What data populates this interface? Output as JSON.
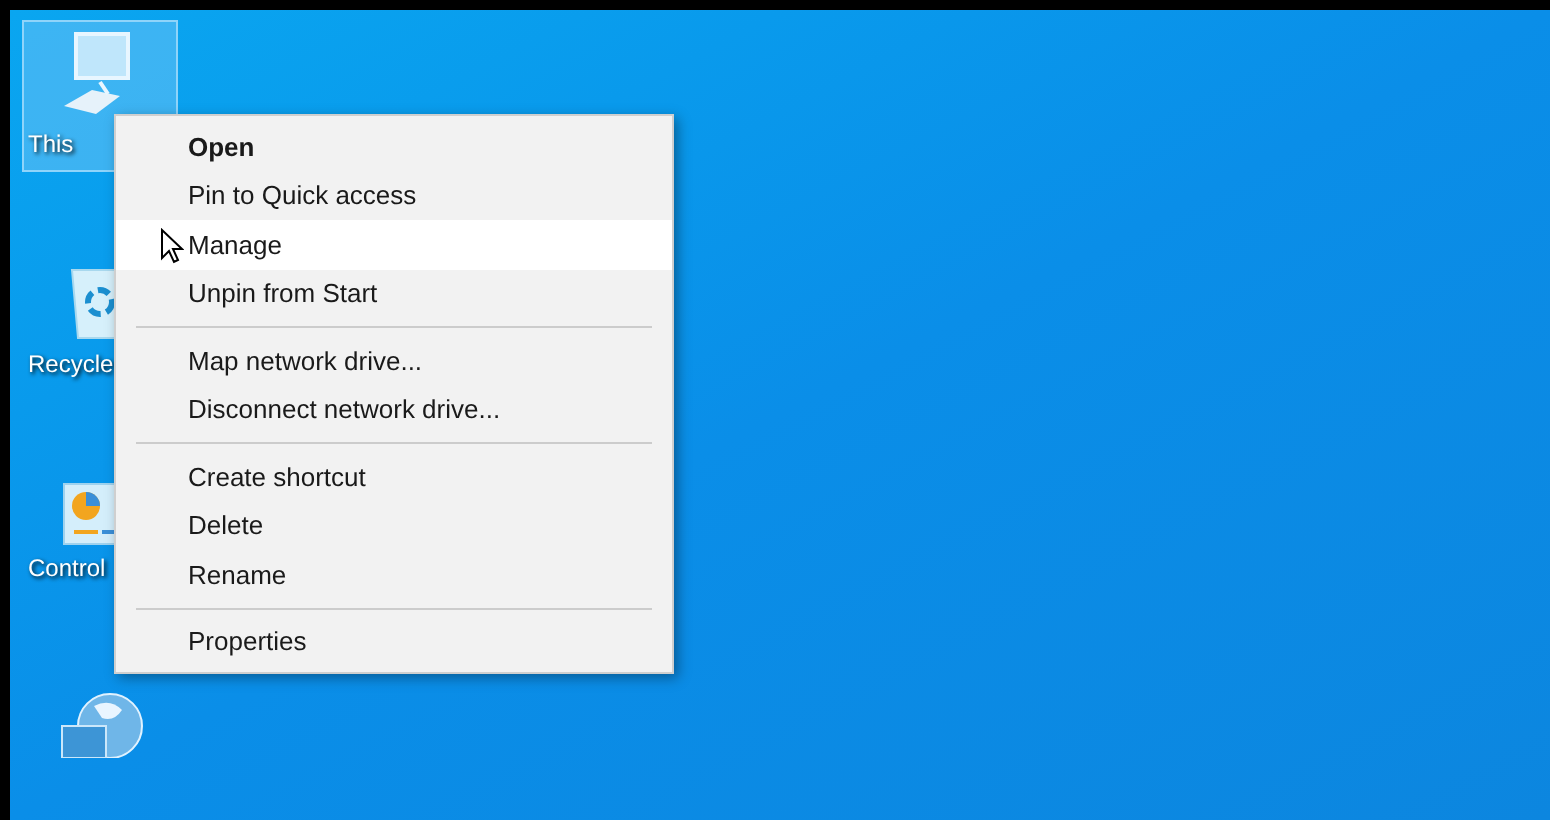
{
  "desktop_icons": [
    {
      "kind": "computer",
      "label": "This",
      "selected": true
    },
    {
      "kind": "recycle",
      "label": "Recycle",
      "selected": false
    },
    {
      "kind": "control",
      "label": "Control",
      "selected": false
    },
    {
      "kind": "network",
      "selected": false
    }
  ],
  "context_menu": {
    "items": [
      {
        "kind": "item",
        "label": "Open",
        "default": true,
        "selected": false
      },
      {
        "kind": "item",
        "label": "Pin to Quick access",
        "default": false,
        "selected": false
      },
      {
        "kind": "item",
        "label": "Manage",
        "default": false,
        "selected": true
      },
      {
        "kind": "item",
        "label": "Unpin from Start",
        "default": false,
        "selected": false
      },
      {
        "kind": "separator"
      },
      {
        "kind": "item",
        "label": "Map network drive...",
        "default": false,
        "selected": false
      },
      {
        "kind": "item",
        "label": "Disconnect network drive...",
        "default": false,
        "selected": false
      },
      {
        "kind": "separator"
      },
      {
        "kind": "item",
        "label": "Create shortcut",
        "default": false,
        "selected": false
      },
      {
        "kind": "item",
        "label": "Delete",
        "default": false,
        "selected": false
      },
      {
        "kind": "item",
        "label": "Rename",
        "default": false,
        "selected": false
      },
      {
        "kind": "separator"
      },
      {
        "kind": "item",
        "label": "Properties",
        "default": false,
        "selected": false
      }
    ]
  }
}
